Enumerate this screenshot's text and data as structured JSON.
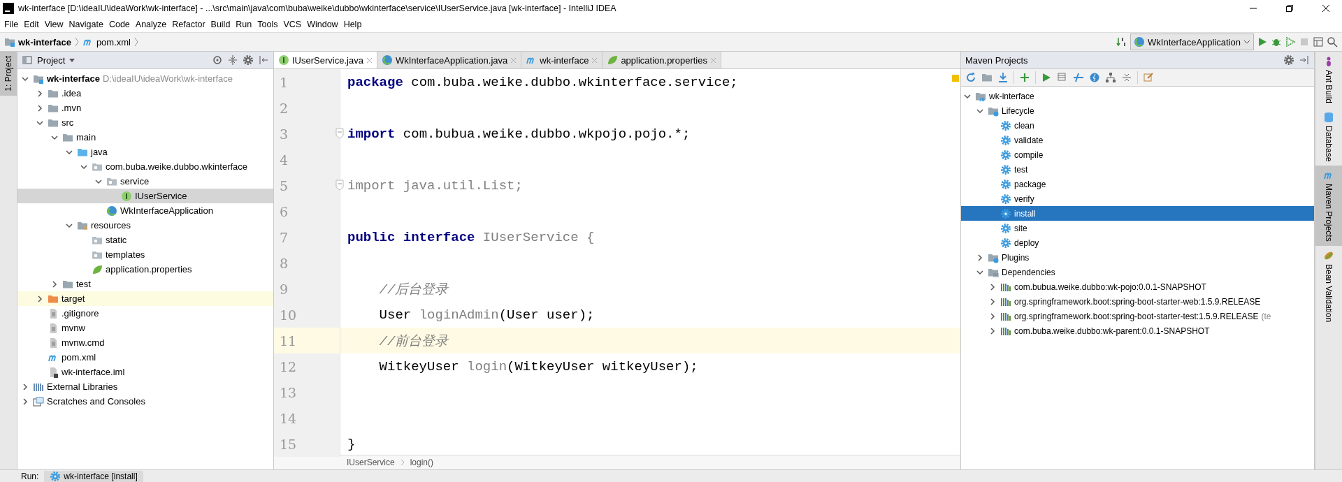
{
  "window": {
    "title": "wk-interface [D:\\ideaIU\\ideaWork\\wk-interface] - ...\\src\\main\\java\\com\\buba\\weike\\dubbo\\wkinterface\\service\\IUserService.java [wk-interface] - IntelliJ IDEA"
  },
  "menu": [
    "File",
    "Edit",
    "View",
    "Navigate",
    "Code",
    "Analyze",
    "Refactor",
    "Build",
    "Run",
    "Tools",
    "VCS",
    "Window",
    "Help"
  ],
  "nav_bar": {
    "crumbs": [
      {
        "label": "wk-interface",
        "kind": "module"
      },
      {
        "label": "pom.xml",
        "kind": "maven-file"
      }
    ],
    "run_config": "WkInterfaceApplication"
  },
  "left_strip": [
    {
      "label": "1: Project",
      "selected": true
    }
  ],
  "project_panel": {
    "title": "Project",
    "tree": [
      {
        "label": "wk-interface",
        "kind": "module",
        "path": "D:\\ideaIU\\ideaWork\\wk-interface",
        "expanded": true,
        "selected": false,
        "children": [
          {
            "label": ".idea",
            "kind": "folder",
            "expanded": false,
            "selected": false
          },
          {
            "label": ".mvn",
            "kind": "folder",
            "expanded": false,
            "selected": false
          },
          {
            "label": "src",
            "kind": "folder",
            "expanded": true,
            "selected": false,
            "children": [
              {
                "label": "main",
                "kind": "folder",
                "expanded": true,
                "selected": false,
                "children": [
                  {
                    "label": "java",
                    "kind": "source-folder",
                    "expanded": true,
                    "selected": false,
                    "children": [
                      {
                        "label": "com.buba.weike.dubbo.wkinterface",
                        "kind": "package",
                        "expanded": true,
                        "selected": false,
                        "children": [
                          {
                            "label": "service",
                            "kind": "package",
                            "expanded": true,
                            "selected": false,
                            "children": [
                              {
                                "label": "IUserService",
                                "kind": "interface",
                                "selected": true
                              }
                            ]
                          },
                          {
                            "label": "WkInterfaceApplication",
                            "kind": "spring-class",
                            "selected": false
                          }
                        ]
                      }
                    ]
                  },
                  {
                    "label": "resources",
                    "kind": "resource-folder",
                    "expanded": true,
                    "selected": false,
                    "children": [
                      {
                        "label": "static",
                        "kind": "package",
                        "selected": false
                      },
                      {
                        "label": "templates",
                        "kind": "package",
                        "selected": false
                      },
                      {
                        "label": "application.properties",
                        "kind": "properties",
                        "selected": false
                      }
                    ]
                  }
                ]
              },
              {
                "label": "test",
                "kind": "folder",
                "expanded": false,
                "selected": false
              }
            ]
          },
          {
            "label": "target",
            "kind": "excluded-folder",
            "expanded": false,
            "selected": false
          },
          {
            "label": ".gitignore",
            "kind": "file",
            "selected": false
          },
          {
            "label": "mvnw",
            "kind": "file",
            "selected": false
          },
          {
            "label": "mvnw.cmd",
            "kind": "file",
            "selected": false
          },
          {
            "label": "pom.xml",
            "kind": "maven-file",
            "selected": false
          },
          {
            "label": "wk-interface.iml",
            "kind": "iml",
            "selected": false
          }
        ]
      },
      {
        "label": "External Libraries",
        "kind": "libraries",
        "expanded": false,
        "selected": false
      },
      {
        "label": "Scratches and Consoles",
        "kind": "scratches",
        "expanded": false,
        "selected": false
      }
    ]
  },
  "editor": {
    "tabs": [
      {
        "label": "IUserService.java",
        "kind": "interface",
        "selected": true
      },
      {
        "label": "WkInterfaceApplication.java",
        "kind": "spring-class",
        "selected": false
      },
      {
        "label": "wk-interface",
        "kind": "maven-file",
        "selected": false
      },
      {
        "label": "application.properties",
        "kind": "properties",
        "selected": false
      }
    ],
    "lines": [
      {
        "number": "1",
        "current": false,
        "fold": false,
        "tokens": [
          {
            "kind": "keyword",
            "text": "package"
          },
          {
            "kind": "plain",
            "text": " com.buba.weike.dubbo.wkinterface.service;"
          }
        ]
      },
      {
        "number": "2",
        "current": false,
        "fold": false
      },
      {
        "number": "3",
        "current": false,
        "fold": true,
        "tokens": [
          {
            "kind": "keyword",
            "text": "import"
          },
          {
            "kind": "plain",
            "text": " com.bubua.weike.dubbo.wkpojo.pojo.*;"
          }
        ]
      },
      {
        "number": "4",
        "current": false,
        "fold": false
      },
      {
        "number": "5",
        "current": false,
        "fold": true,
        "tokens": [
          {
            "kind": "unused",
            "text": "import java.util.List;"
          }
        ]
      },
      {
        "number": "6",
        "current": false,
        "fold": false
      },
      {
        "number": "7",
        "current": false,
        "fold": false,
        "tokens": [
          {
            "kind": "keyword",
            "text": "public interface"
          },
          {
            "kind": "unused",
            "text": " IUserService {"
          }
        ]
      },
      {
        "number": "8",
        "current": false,
        "fold": false
      },
      {
        "number": "9",
        "current": false,
        "fold": false,
        "tokens": [
          {
            "kind": "comment",
            "text": "    //后台登录"
          }
        ]
      },
      {
        "number": "10",
        "current": false,
        "fold": false,
        "tokens": [
          {
            "kind": "plain",
            "text": "    User "
          },
          {
            "kind": "unused",
            "text": "loginAdmin"
          },
          {
            "kind": "plain",
            "text": "(User user);"
          }
        ]
      },
      {
        "number": "11",
        "current": true,
        "fold": false,
        "tokens": [
          {
            "kind": "comment",
            "text": "    //前台登录"
          }
        ]
      },
      {
        "number": "12",
        "current": false,
        "fold": false,
        "tokens": [
          {
            "kind": "plain",
            "text": "    WitkeyUser "
          },
          {
            "kind": "unused",
            "text": "login"
          },
          {
            "kind": "plain",
            "text": "(WitkeyUser witkeyUser);"
          }
        ]
      },
      {
        "number": "13",
        "current": false,
        "fold": false
      },
      {
        "number": "14",
        "current": false,
        "fold": false
      },
      {
        "number": "15",
        "current": false,
        "fold": false,
        "tokens": [
          {
            "kind": "plain",
            "text": "}"
          }
        ]
      }
    ],
    "breadcrumb": [
      "IUserService",
      "login()"
    ]
  },
  "maven_panel": {
    "title": "Maven Projects",
    "tree": [
      {
        "label": "wk-interface",
        "kind": "maven-module",
        "expanded": true,
        "selected": false,
        "children": [
          {
            "label": "Lifecycle",
            "kind": "lifecycle",
            "expanded": true,
            "selected": false,
            "children": [
              {
                "label": "clean",
                "kind": "goal",
                "selected": false
              },
              {
                "label": "validate",
                "kind": "goal",
                "selected": false
              },
              {
                "label": "compile",
                "kind": "goal",
                "selected": false
              },
              {
                "label": "test",
                "kind": "goal",
                "selected": false
              },
              {
                "label": "package",
                "kind": "goal",
                "selected": false
              },
              {
                "label": "verify",
                "kind": "goal",
                "selected": false
              },
              {
                "label": "install",
                "kind": "goal",
                "selected": true
              },
              {
                "label": "site",
                "kind": "goal",
                "selected": false
              },
              {
                "label": "deploy",
                "kind": "goal",
                "selected": false
              }
            ]
          },
          {
            "label": "Plugins",
            "kind": "lifecycle",
            "expanded": false,
            "selected": false
          },
          {
            "label": "Dependencies",
            "kind": "dependencies",
            "expanded": true,
            "selected": false,
            "children": [
              {
                "label": "com.bubua.weike.dubbo:wk-pojo:0.0.1-SNAPSHOT",
                "kind": "dependency",
                "expanded": false,
                "selected": false
              },
              {
                "label": "org.springframework.boot:spring-boot-starter-web:1.5.9.RELEASE",
                "kind": "dependency",
                "expanded": false,
                "selected": false
              },
              {
                "label": "org.springframework.boot:spring-boot-starter-test:1.5.9.RELEASE",
                "kind": "dependency",
                "path": "(te",
                "expanded": false,
                "selected": false
              },
              {
                "label": "com.buba.weike.dubbo:wk-parent:0.0.1-SNAPSHOT",
                "kind": "dependency",
                "expanded": false,
                "selected": false
              }
            ]
          }
        ]
      }
    ]
  },
  "right_strip": [
    {
      "label": "Ant Build",
      "kind": "ant",
      "selected": false
    },
    {
      "label": "Database",
      "kind": "database",
      "selected": false
    },
    {
      "label": "Maven Projects",
      "kind": "maven",
      "selected": true
    },
    {
      "label": "Bean Validation",
      "kind": "bean",
      "selected": false
    }
  ],
  "run_bar": {
    "label": "Run:",
    "tab": "wk-interface [install]"
  }
}
